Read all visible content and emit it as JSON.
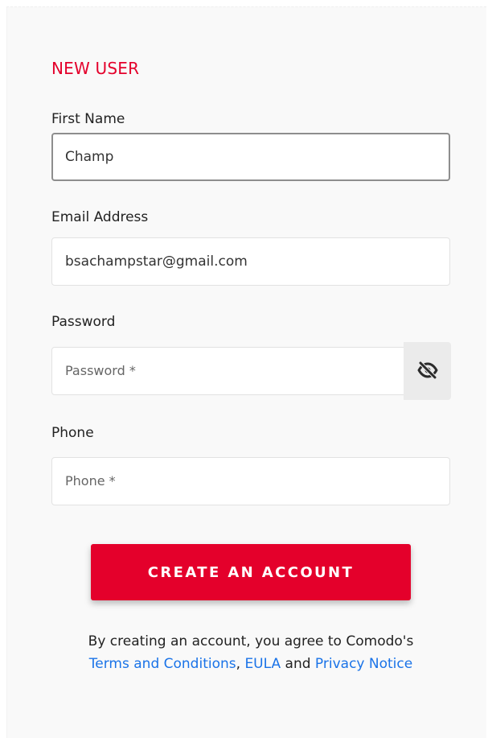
{
  "form": {
    "section_title": "NEW USER",
    "first_name": {
      "label": "First Name",
      "value": "Champ"
    },
    "email": {
      "label": "Email Address",
      "value": "bsachampstar@gmail.com"
    },
    "password": {
      "label": "Password",
      "placeholder": "Password *",
      "toggle_icon": "eye-slash-icon"
    },
    "phone": {
      "label": "Phone",
      "placeholder": "Phone *"
    },
    "submit_label": "CREATE AN ACCOUNT",
    "terms": {
      "prefix": "By creating an account, you agree to Comodo's",
      "terms_link": "Terms and Conditions",
      "comma": ",",
      "eula_link": "EULA",
      "and_text": "and",
      "privacy_link": "Privacy Notice"
    }
  },
  "colors": {
    "accent": "#e4002b",
    "link": "#1a73e8",
    "toggle_bg": "#ebebeb"
  }
}
